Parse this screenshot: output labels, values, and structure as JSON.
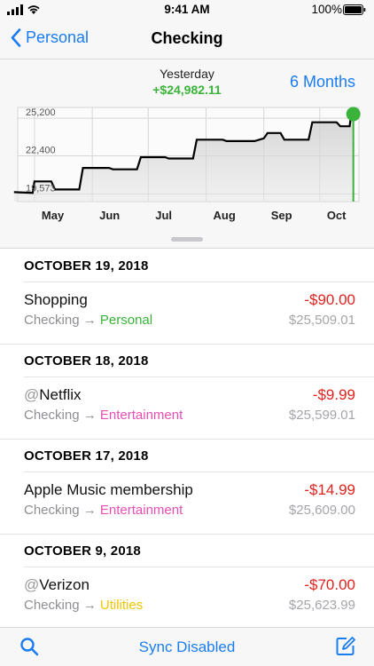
{
  "status_bar": {
    "time": "9:41 AM",
    "battery": "100%"
  },
  "nav": {
    "back_label": "Personal",
    "title": "Checking"
  },
  "chart_header": {
    "period": "Yesterday",
    "change": "+$24,982.11",
    "range": "6 Months"
  },
  "chart_data": {
    "type": "line",
    "title": "",
    "xlabel": "",
    "ylabel": "",
    "x_tick_labels": [
      "May",
      "Jun",
      "Jul",
      "Aug",
      "Sep",
      "Oct"
    ],
    "y_tick_labels": [
      "25,200",
      "22,400",
      "19,573"
    ],
    "ylim": [
      19000,
      26000
    ],
    "series": [
      {
        "x": [
          "2018-04-20",
          "2018-04-30",
          "2018-05-01",
          "2018-05-10",
          "2018-05-12",
          "2018-05-25",
          "2018-05-27",
          "2018-06-10",
          "2018-06-12",
          "2018-06-25",
          "2018-06-27",
          "2018-07-10",
          "2018-07-12",
          "2018-07-25",
          "2018-07-27",
          "2018-08-10",
          "2018-08-12",
          "2018-08-25",
          "2018-08-27",
          "2018-09-01",
          "2018-09-03",
          "2018-09-10",
          "2018-09-12",
          "2018-09-25",
          "2018-09-27",
          "2018-10-10",
          "2018-10-12",
          "2018-10-17",
          "2018-10-18",
          "2018-10-19"
        ],
        "y": [
          19700,
          19650,
          20500,
          20500,
          19900,
          19900,
          21500,
          21500,
          21400,
          21400,
          22300,
          22300,
          22200,
          22200,
          23600,
          23600,
          23500,
          23500,
          23500,
          23700,
          24100,
          24100,
          23600,
          23600,
          24900,
          24900,
          24600,
          24600,
          25650,
          25510
        ]
      }
    ],
    "end_marker_value": 25510,
    "grid": true,
    "legend": "none"
  },
  "sections": [
    {
      "date": "OCTOBER 19, 2018",
      "transactions": [
        {
          "at": "",
          "payee": "Shopping",
          "amount": "-$90.00",
          "from": "Checking",
          "arrow": "→",
          "category": "Personal",
          "category_color": "#3ab33a",
          "balance": "$25,509.01"
        }
      ]
    },
    {
      "date": "OCTOBER 18, 2018",
      "transactions": [
        {
          "at": "@",
          "payee": "Netflix",
          "amount": "-$9.99",
          "from": "Checking",
          "arrow": "→",
          "category": "Entertainment",
          "category_color": "#e84fb4",
          "balance": "$25,599.01"
        }
      ]
    },
    {
      "date": "OCTOBER 17, 2018",
      "transactions": [
        {
          "at": "",
          "payee": "Apple Music membership",
          "amount": "-$14.99",
          "from": "Checking",
          "arrow": "→",
          "category": "Entertainment",
          "category_color": "#e84fb4",
          "balance": "$25,609.00"
        }
      ]
    },
    {
      "date": "OCTOBER 9, 2018",
      "transactions": [
        {
          "at": "@",
          "payee": "Verizon",
          "amount": "-$70.00",
          "from": "Checking",
          "arrow": "→",
          "category": "Utilities",
          "category_color": "#f2c500",
          "balance": "$25,623.99"
        }
      ]
    }
  ],
  "tab_bar": {
    "sync_label": "Sync Disabled"
  },
  "icons": {
    "back": "chevron-left-icon",
    "search": "search-icon",
    "compose": "compose-icon",
    "signal": "signal-icon",
    "wifi": "wifi-icon",
    "battery": "battery-icon"
  },
  "colors": {
    "accent": "#1a7cf2",
    "positive": "#3ab33a",
    "negative": "#e0231f"
  }
}
